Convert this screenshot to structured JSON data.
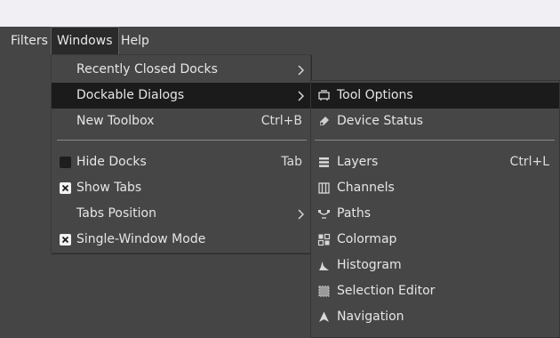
{
  "menubar": {
    "filters": "Filters",
    "windows": "Windows",
    "help": "Help"
  },
  "windows_menu": {
    "items": [
      {
        "label": "Recently Closed Docks",
        "submenu": true
      },
      {
        "label": "Dockable Dialogs",
        "submenu": true,
        "highlighted": true
      },
      {
        "label": "New Toolbox",
        "shortcut": "Ctrl+B"
      },
      {
        "label": "Hide Docks",
        "shortcut": "Tab",
        "checked": false
      },
      {
        "label": "Show Tabs",
        "checked": true
      },
      {
        "label": "Tabs Position",
        "submenu": true
      },
      {
        "label": "Single-Window Mode",
        "checked": true
      }
    ]
  },
  "dockable_dialogs_menu": {
    "items": [
      {
        "label": "Tool Options",
        "icon": "tool-options-icon",
        "highlighted": true
      },
      {
        "label": "Device Status",
        "icon": "device-status-icon"
      },
      {
        "label": "Layers",
        "icon": "layers-icon",
        "shortcut": "Ctrl+L"
      },
      {
        "label": "Channels",
        "icon": "channels-icon"
      },
      {
        "label": "Paths",
        "icon": "paths-icon"
      },
      {
        "label": "Colormap",
        "icon": "colormap-icon"
      },
      {
        "label": "Histogram",
        "icon": "histogram-icon"
      },
      {
        "label": "Selection Editor",
        "icon": "selection-editor-icon"
      },
      {
        "label": "Navigation",
        "icon": "navigation-icon"
      }
    ]
  },
  "colors": {
    "background": "#454545",
    "menu_bg": "#464646",
    "highlight": "#1b1b1b",
    "text": "#e6e6e6"
  }
}
